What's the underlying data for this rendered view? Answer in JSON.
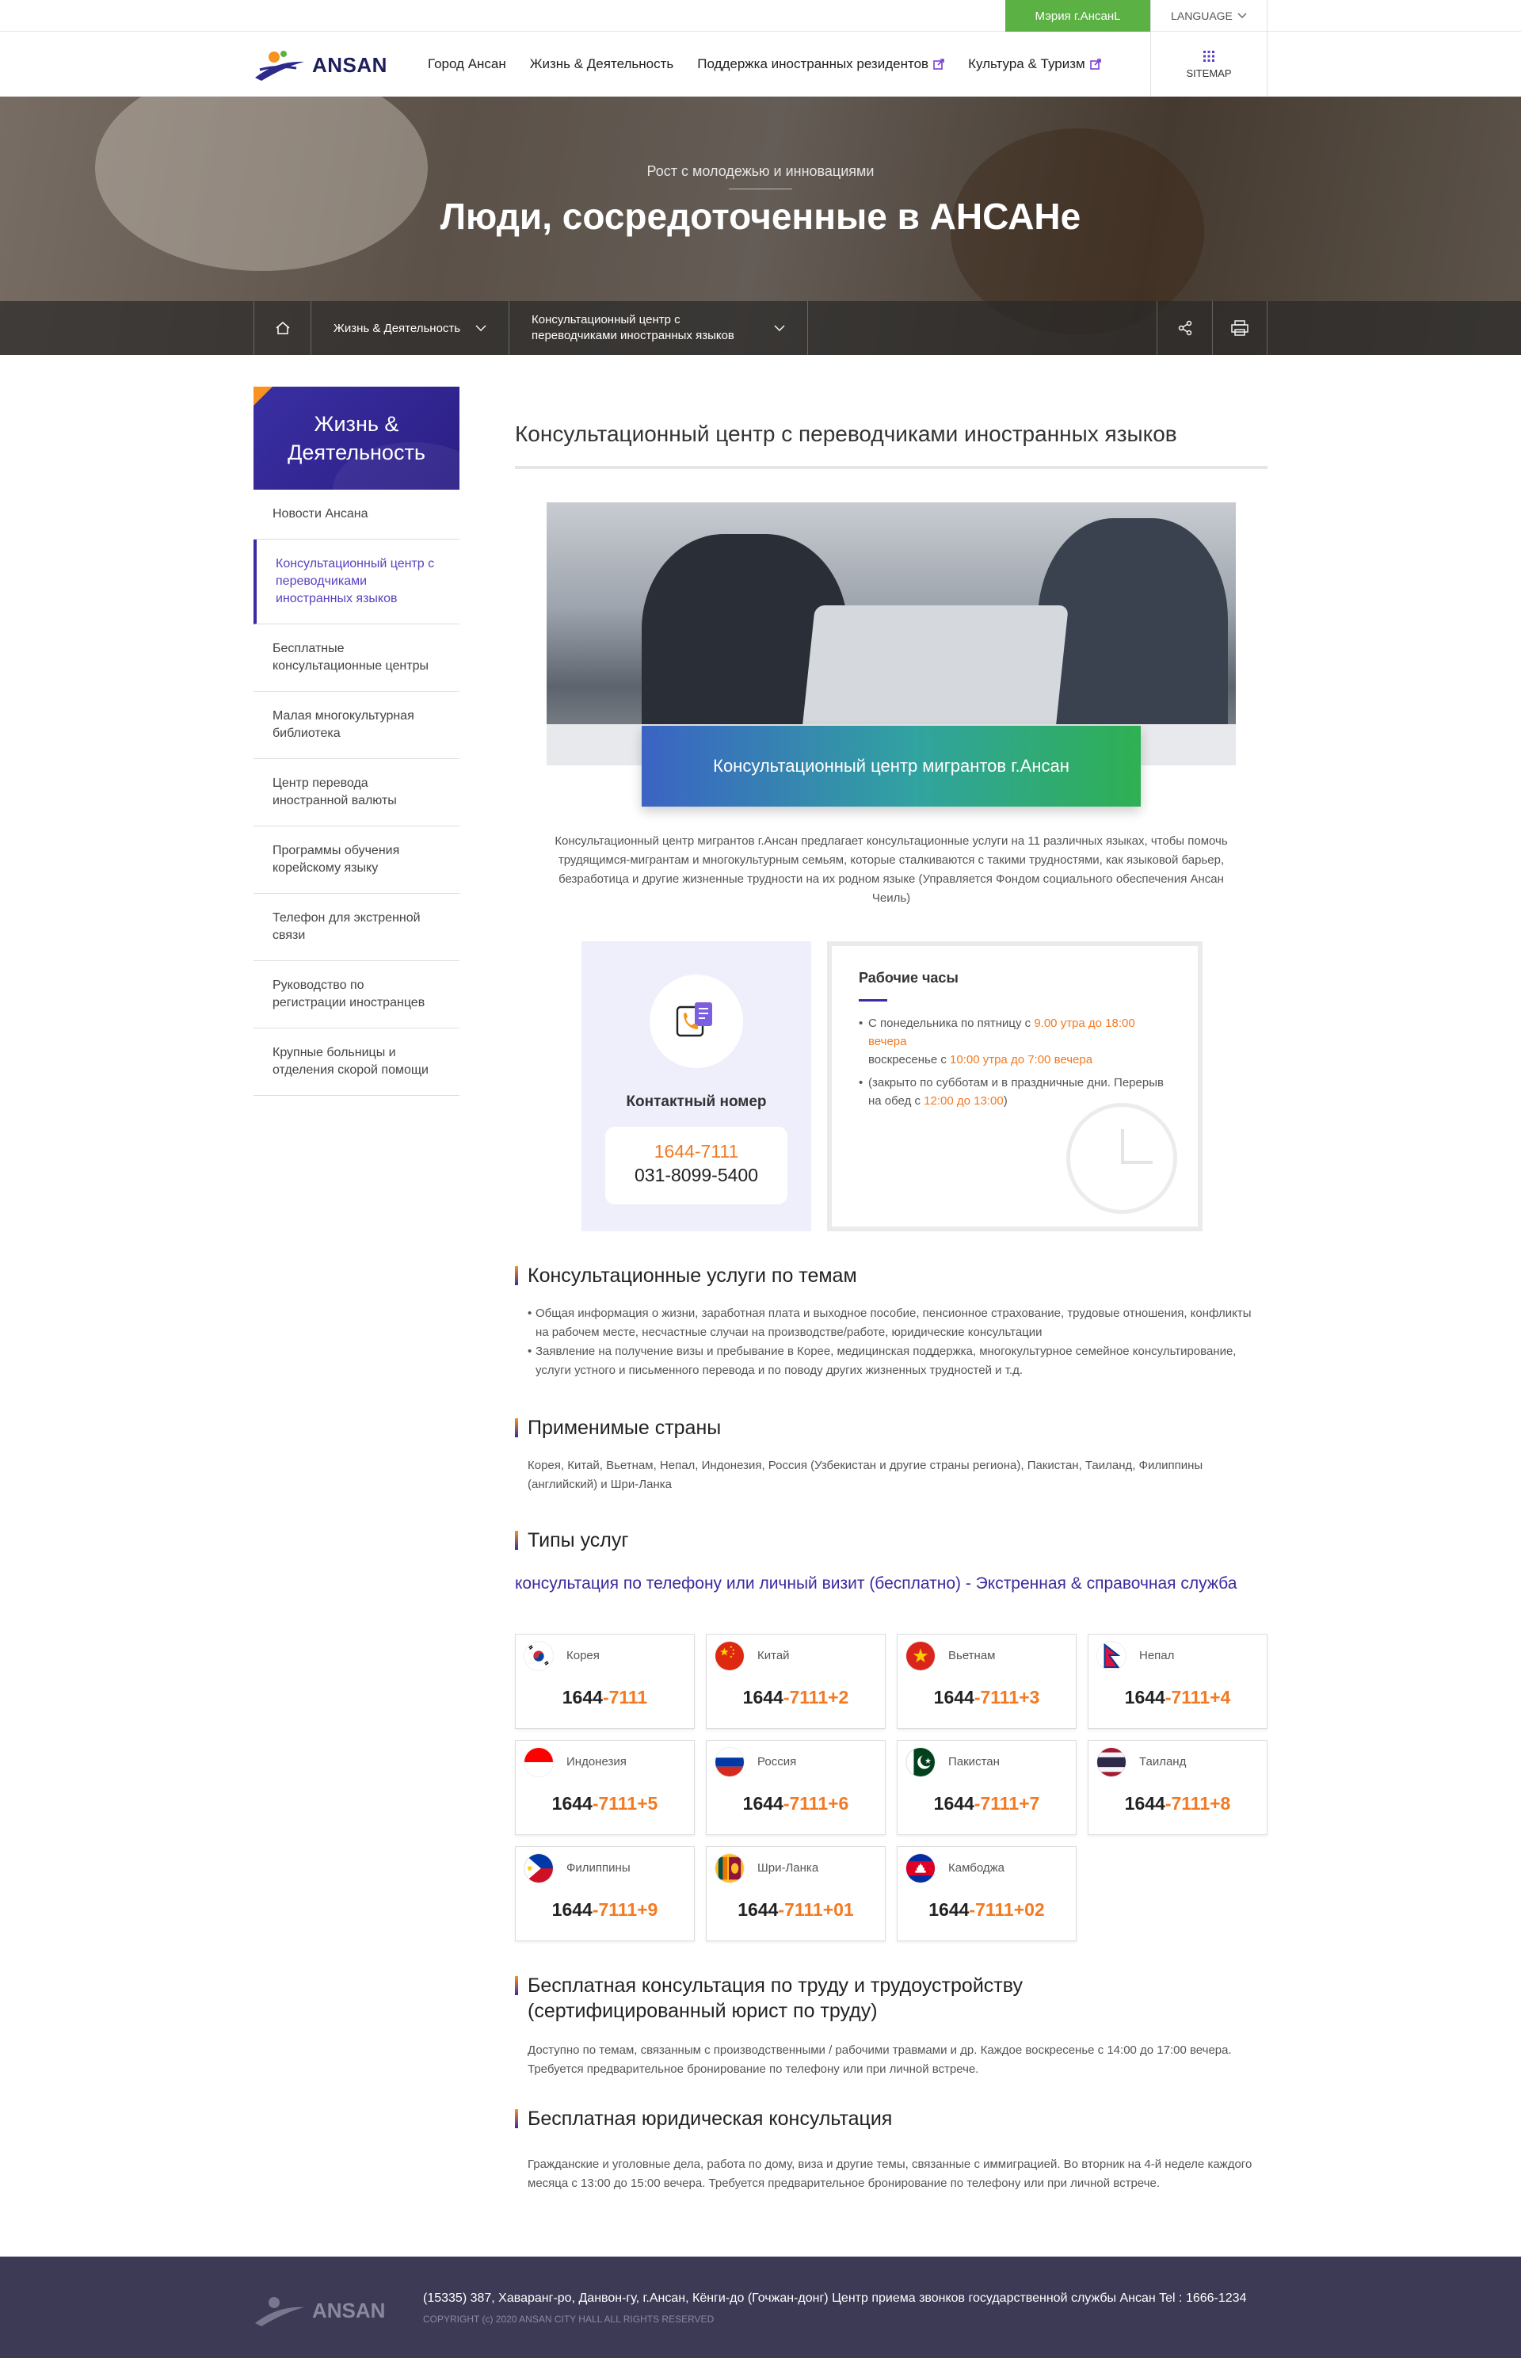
{
  "topbar": {
    "city_link": "Мэрия г.АнсанL",
    "language": "LANGUAGE"
  },
  "header": {
    "logo": "ANSAN",
    "nav": [
      "Город Ансан",
      "Жизнь & Деятельность",
      "Поддержка иностранных резидентов",
      "Культура & Туризм"
    ],
    "sitemap": "SITEMAP"
  },
  "hero": {
    "subtitle": "Рост с молодежью и инновациями",
    "title": "Люди, сосредоточенные в АНСАНе",
    "crumb1": "Жизнь & Деятельность",
    "crumb2_line1": "Консультационный центр с",
    "crumb2_line2": "переводчиками иностранных языков"
  },
  "sidebar": {
    "title_line1": "Жизнь &",
    "title_line2": "Деятельность",
    "items": [
      "Новости Ансана",
      "Консультационный центр с переводчиками иностранных языков",
      "Бесплатные консультационные центры",
      "Малая многокультурная библиотека",
      "Центр перевода иностранной валюты",
      "Программы обучения корейскому языку",
      "Телефон для экстренной связи",
      "Руководство по регистрации иностранцев",
      "Крупные больницы и отделения скорой помощи"
    ]
  },
  "main": {
    "page_title": "Консультационный центр с переводчиками иностранных языков",
    "photo_label": "Консультационный центр мигрантов г.Ансан",
    "intro": "Консультационный центр мигрантов г.Ансан предлагает консультационные услуги на 11 различных языках, чтобы помочь трудящимся-мигрантам и многокультурным семьям, которые сталкиваются с такими трудностями, как языковой барьер, безработица и другие жизненные трудности на их родном языке (Управляется Фондом социального обеспечения Ансан Чеиль)",
    "contact": {
      "title": "Контактный номер",
      "phone1": "1644-7111",
      "phone2": "031-8099-5400"
    },
    "hours": {
      "title": "Рабочие часы",
      "l1a": "С понедельника по пятницу с ",
      "l1b": "9.00 утра до 18:00 вечера",
      "l2a": "воскресенье с ",
      "l2b": "10:00 утра до 7:00 вечера",
      "l3a": "(закрыто по субботам и в праздничные дни. Перерыв на обед с ",
      "l3b": "12:00 до 13:00",
      "l3c": ")"
    },
    "topics": {
      "title": "Консультационные услуги по темам",
      "b1": "Общая информация о жизни, заработная плата и выходное пособие, пенсионное страхование, трудовые отношения, конфликты на рабочем месте, несчастные случаи на производстве/работе, юридические консультации",
      "b2": "Заявление на получение визы и пребывание в Корее, медицинская поддержка, многокультурное семейное консультирование, услуги устного и письменного перевода и по поводу других жизненных трудностей и т.д."
    },
    "countries": {
      "title": "Применимые страны",
      "body": "Корея, Китай, Вьетнам, Непал, Индонезия, Россия (Узбекистан и другие страны региона), Пакистан, Таиланд, Филиппины (английский) и Шри-Ланка"
    },
    "service_types": {
      "title": "Типы услуг",
      "subhead": "консультация по телефону или личный визит (бесплатно) - Экстренная & справочная служба",
      "cards": [
        {
          "name": "Корея",
          "base": "1644",
          "suffix": "-7111",
          "flag": "kr"
        },
        {
          "name": "Китай",
          "base": "1644",
          "suffix": "-7111+2",
          "flag": "cn"
        },
        {
          "name": "Вьетнам",
          "base": "1644",
          "suffix": "-7111+3",
          "flag": "vn"
        },
        {
          "name": "Непал",
          "base": "1644",
          "suffix": "-7111+4",
          "flag": "np"
        },
        {
          "name": "Индонезия",
          "base": "1644",
          "suffix": "-7111+5",
          "flag": "id"
        },
        {
          "name": "Россия",
          "base": "1644",
          "suffix": "-7111+6",
          "flag": "ru"
        },
        {
          "name": "Пакистан",
          "base": "1644",
          "suffix": "-7111+7",
          "flag": "pk"
        },
        {
          "name": "Таиланд",
          "base": "1644",
          "suffix": "-7111+8",
          "flag": "th"
        },
        {
          "name": "Филиппины",
          "base": "1644",
          "suffix": "-7111+9",
          "flag": "ph"
        },
        {
          "name": "Шри-Ланка",
          "base": "1644",
          "suffix": "-7111+01",
          "flag": "lk"
        },
        {
          "name": "Камбоджа",
          "base": "1644",
          "suffix": "-7111+02",
          "flag": "kh"
        }
      ]
    },
    "labor": {
      "title_line1": "Бесплатная консультация по труду и трудоустройству",
      "title_line2": "(сертифицированный юрист по труду)",
      "body": "Доступно по темам, связанным с производственными / рабочими травмами и др. Каждое воскресенье с 14:00 до 17:00 вечера. Требуется предварительное бронирование по телефону или при личной встрече."
    },
    "legal": {
      "title": "Бесплатная юридическая консультация",
      "body": "Гражданские и уголовные дела, работа по дому, виза и другие темы, связанные с иммиграцией. Во вторник на 4-й неделе каждого месяца с 13:00 до 15:00 вечера. Требуется предварительное бронирование по телефону или при личной встрече."
    }
  },
  "footer": {
    "logo": "ANSAN",
    "address": "(15335) 387, Хаваранг-ро, Данвон-гу, г.Ансан, Кёнги-до (Гочжан-донг) Центр приема звонков государственной службы Ансан     Tel : 1666-1234",
    "copyright": "COPYRIGHT (c) 2020 ANSAN CITY HALL ALL RIGHTS RESERVED"
  }
}
